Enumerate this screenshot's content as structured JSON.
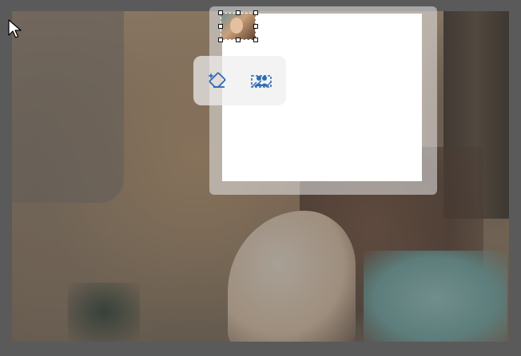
{
  "canvas": {
    "photo": "woman-with-sunglasses-photo"
  },
  "toolbar": {
    "tools": [
      {
        "icon": "magic-eraser-icon",
        "tooltip": ""
      },
      {
        "icon": "remove-background-people-icon",
        "tooltip": ""
      }
    ],
    "accent_color": "#2f6ab3"
  },
  "layers_panel": {
    "thumbnail": "photo-thumbnail"
  },
  "colors": {
    "backdrop": "#5a5a5a",
    "panel": "#ffffff"
  }
}
